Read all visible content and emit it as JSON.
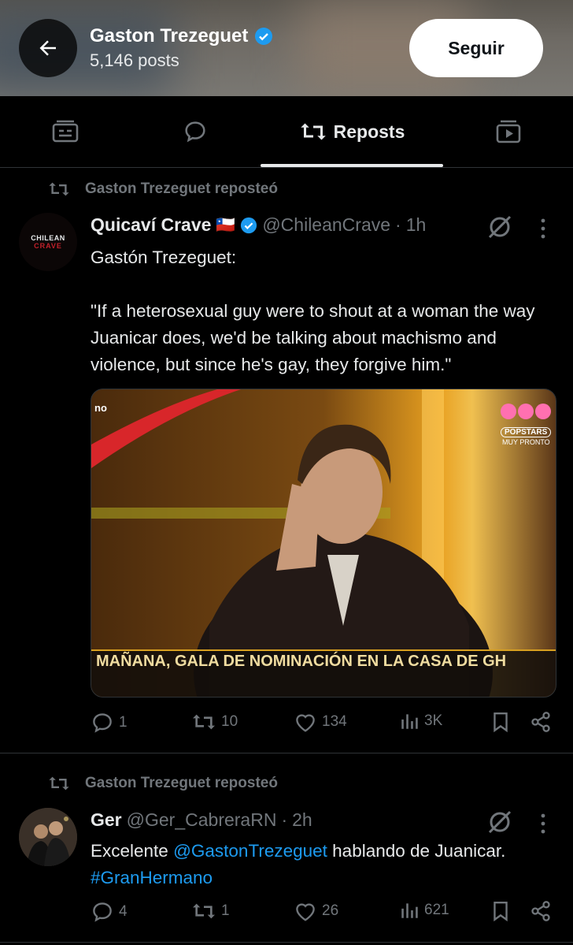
{
  "header": {
    "name": "Gaston Trezeguet",
    "posts": "5,146 posts",
    "follow_label": "Seguir"
  },
  "tabs": {
    "active_label": "Reposts",
    "icons": [
      "highlights-icon",
      "replies-icon",
      "reposts-icon",
      "media-icon"
    ]
  },
  "posts": [
    {
      "repost_label": "Gaston Trezeguet reposteó",
      "avatar_text_top": "CHILEAN",
      "avatar_text_bottom": "CRAVE",
      "name": "Quicaví Crave",
      "flag": "🇨🇱",
      "handle": "@ChileanCrave",
      "dot": "·",
      "time": "1h",
      "text": "Gastón Trezeguet:\n\n\"If a heterosexual guy were to shout at a woman the way Juanicar does, we'd be talking about machismo and violence, but since he's gay, they forgive him.\"",
      "media": {
        "corner_text": "no",
        "brand": "POPSTARS",
        "brand_sub": "MUY PRONTO",
        "caption": "MAÑANA, GALA DE NOMINACIÓN EN LA CASA DE GH"
      },
      "stats": {
        "replies": "1",
        "reposts": "10",
        "likes": "134",
        "views": "3K"
      }
    },
    {
      "repost_label": "Gaston Trezeguet reposteó",
      "name": "Ger",
      "handle": "@Ger_CabreraRN",
      "dot": "·",
      "time": "2h",
      "text_before": "Excelente ",
      "mention": "@GastonTrezeguet",
      "text_after": " hablando de Juanicar.",
      "hashtag": "#GranHermano",
      "stats": {
        "replies": "4",
        "reposts": "1",
        "likes": "26",
        "views": "621"
      }
    }
  ],
  "colors": {
    "accent": "#1d9bf0",
    "muted": "#71767b",
    "text": "#e7e9ea",
    "background": "#000000"
  }
}
